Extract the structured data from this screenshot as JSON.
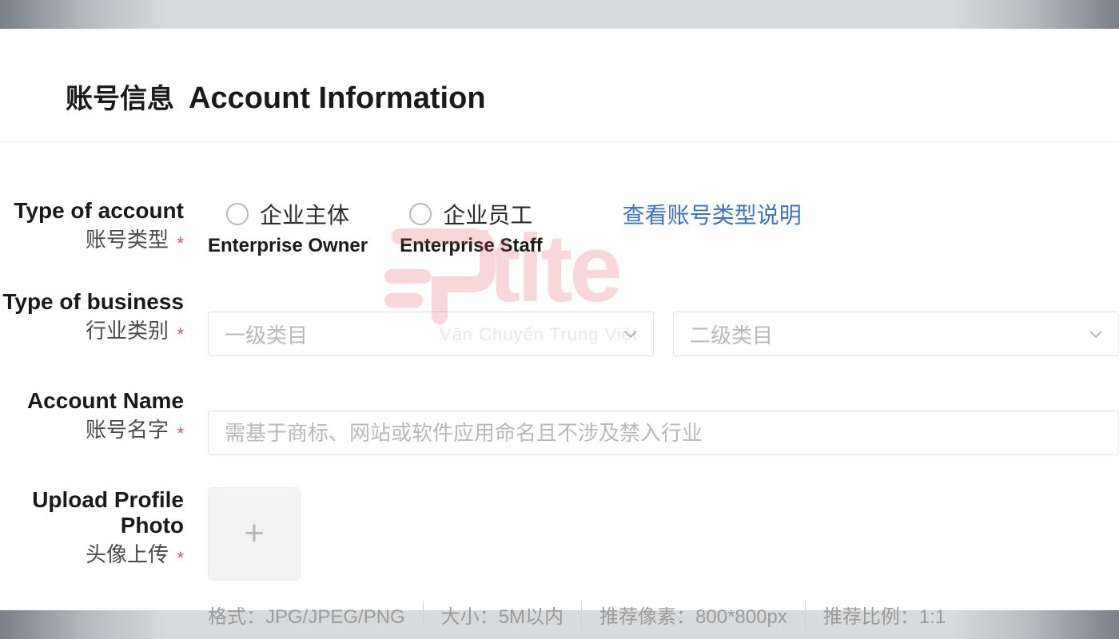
{
  "header": {
    "title_cn": "账号信息",
    "title_en": "Account Information"
  },
  "fields": {
    "account_type": {
      "label_en": "Type of account",
      "label_cn": "账号类型",
      "options": [
        {
          "cn": "企业主体",
          "en": "Enterprise Owner"
        },
        {
          "cn": "企业员工",
          "en": "Enterprise Staff"
        }
      ],
      "help_link": "查看账号类型说明"
    },
    "business_type": {
      "label_en": "Type of business",
      "label_cn": "行业类别",
      "select1_placeholder": "一级类目",
      "select2_placeholder": "二级类目"
    },
    "account_name": {
      "label_en": "Account Name",
      "label_cn": "账号名字",
      "placeholder": "需基于商标、网站或软件应用命名且不涉及禁入行业"
    },
    "profile_photo": {
      "label_en": "Upload Profile Photo",
      "label_cn": "头像上传",
      "hints": {
        "format": "格式：JPG/JPEG/PNG",
        "size": "大小：5M以内",
        "pixels": "推荐像素：800*800px",
        "ratio": "推荐比例：1:1"
      }
    }
  },
  "required_mark": "*",
  "watermark": {
    "brand": "Ptite",
    "tagline": "Vận Chuyển Trung Việt"
  }
}
